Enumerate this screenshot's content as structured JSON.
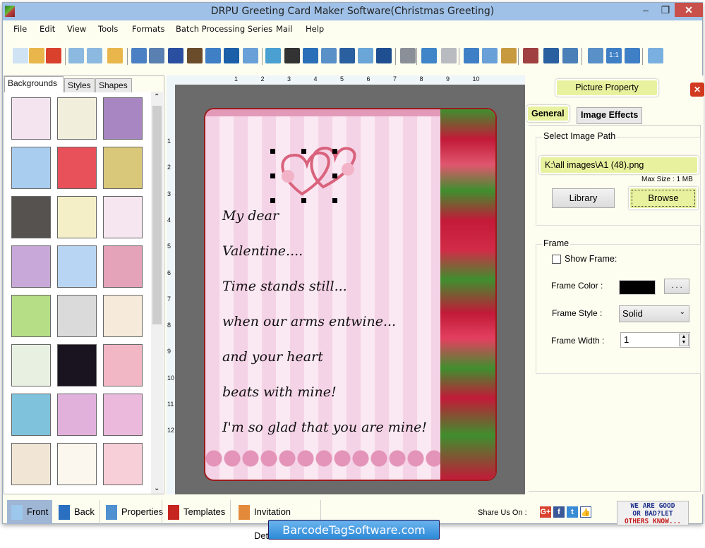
{
  "window": {
    "title": "DRPU Greeting Card Maker Software(Christmas Greeting)",
    "controls": {
      "minimize": "–",
      "maximize": "❐",
      "close": "✕"
    }
  },
  "menu": [
    "File",
    "Edit",
    "View",
    "Tools",
    "Formats",
    "Batch Processing Series",
    "Mail",
    "Help"
  ],
  "toolbar": {
    "icons": [
      "new-icon",
      "open-icon",
      "close-file-icon",
      "save-icon",
      "save-as-icon",
      "export-icon",
      "properties-icon",
      "print-icon",
      "background-icon",
      "card-design-icon",
      "insert-image-icon",
      "signature-icon",
      "shapes-icon",
      "watermark-icon",
      "barcode-icon",
      "text-icon",
      "word-art-icon",
      "symbol-icon",
      "email-icon",
      "line-icon",
      "database-icon",
      "undo-icon",
      "redo-icon",
      "cut-icon",
      "copy-icon",
      "paste-icon",
      "delete-icon",
      "bring-front-icon",
      "send-back-icon",
      "grid-icon",
      "actual-size-icon",
      "fit-window-icon",
      "zoom-in-icon"
    ],
    "zoom_actual_label": "1:1"
  },
  "left_panel": {
    "tabs": [
      "Backgrounds",
      "Styles",
      "Shapes"
    ],
    "active_tab": "Backgrounds",
    "thumbnails": [
      {
        "name": "baby-items",
        "color": "#f4e4f0"
      },
      {
        "name": "stork",
        "color": "#f1eedc"
      },
      {
        "name": "purple-flowers",
        "color": "#a786c2"
      },
      {
        "name": "clouds",
        "color": "#a9cdee"
      },
      {
        "name": "strawberries",
        "color": "#e8505a"
      },
      {
        "name": "leaves",
        "color": "#d9c87a"
      },
      {
        "name": "dark-petals",
        "color": "#55524f"
      },
      {
        "name": "flower-row",
        "color": "#f5efc8"
      },
      {
        "name": "gifts",
        "color": "#f5e6f0"
      },
      {
        "name": "pastel-circles",
        "color": "#c7a8d8"
      },
      {
        "name": "snowflakes",
        "color": "#b8d6f3"
      },
      {
        "name": "mandalas",
        "color": "#e4a3b8"
      },
      {
        "name": "christmas-trees",
        "color": "#b6de86"
      },
      {
        "name": "white-heart",
        "color": "#dadada"
      },
      {
        "name": "kids-toys",
        "color": "#f6eadb"
      },
      {
        "name": "green-hearts",
        "color": "#e8f0e2"
      },
      {
        "name": "fireworks",
        "color": "#1a1420"
      },
      {
        "name": "red-hearts",
        "color": "#f1b7c5"
      },
      {
        "name": "santa",
        "color": "#7fc2dc"
      },
      {
        "name": "pink-spheres",
        "color": "#e1b1dc"
      },
      {
        "name": "pink-flowers",
        "color": "#eab9dc"
      },
      {
        "name": "pastel-stripes",
        "color": "#f1e6d6"
      },
      {
        "name": "teddy-bear",
        "color": "#fbf6ee"
      },
      {
        "name": "princess-dress",
        "color": "#f7cfd8"
      }
    ]
  },
  "canvas": {
    "ruler_top": [
      "1",
      "2",
      "3",
      "4",
      "5",
      "6",
      "7",
      "8",
      "9",
      "10"
    ],
    "ruler_left": [
      "1",
      "2",
      "3",
      "4",
      "5",
      "6",
      "7",
      "8",
      "9",
      "10",
      "11",
      "12"
    ],
    "card_lines": [
      "My dear",
      "Valentine....",
      "Time stands still...",
      "when our arms entwine...",
      "and your heart",
      "beats with mine!",
      "I'm so glad that you are mine!"
    ]
  },
  "property_panel": {
    "title": "Picture Property",
    "tabs": [
      "General",
      "Image Effects"
    ],
    "active_tab": "General",
    "image_path_group": "Select Image Path",
    "image_path": "K:\\all images\\A1 (48).png",
    "max_size": "Max Size : 1 MB",
    "library_button": "Library",
    "browse_button": "Browse",
    "frame_group": "Frame",
    "show_frame_label": "Show Frame:",
    "show_frame_checked": false,
    "frame_color_label": "Frame Color :",
    "frame_color_value": "#000000",
    "color_picker_button": ". . .",
    "frame_style_label": "Frame Style :",
    "frame_style_value": "Solid",
    "frame_width_label": "Frame Width :",
    "frame_width_value": "1"
  },
  "bottom_bar": {
    "items": [
      {
        "label": "Front",
        "icon": "front-page-icon",
        "active": true
      },
      {
        "label": "Back",
        "icon": "back-page-icon",
        "active": false
      },
      {
        "label": "Properties",
        "icon": "properties-doc-icon",
        "active": false
      },
      {
        "label": "Templates",
        "icon": "templates-icon",
        "active": false
      },
      {
        "label": "Invitation Details",
        "icon": "invitation-details-icon",
        "active": false
      }
    ],
    "share_label": "Share Us On :",
    "social": [
      "G+",
      "f",
      "t",
      "👍"
    ],
    "review_lines": [
      "WE ARE GOOD",
      "OR BAD?LET",
      "OTHERS KNOW..."
    ]
  },
  "brand": "BarcodeTagSoftware.com"
}
